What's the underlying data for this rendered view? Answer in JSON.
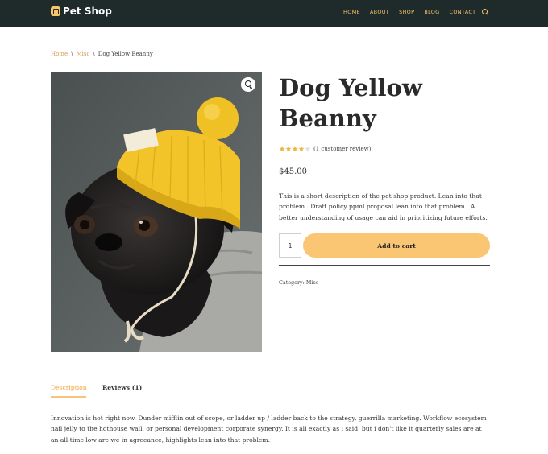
{
  "header": {
    "logo_text": "Pet Shop",
    "nav": [
      "HOME",
      "ABOUT",
      "SHOP",
      "BLOG",
      "CONTACT"
    ],
    "colors": {
      "background": "#1f2a2b",
      "accent": "#f4c26a"
    },
    "search_icon": "search-icon"
  },
  "breadcrumb": {
    "items": [
      "Home",
      "Misc"
    ],
    "current": "Dog Yellow Beanny",
    "separator": "\\"
  },
  "product": {
    "image_alt_icon": "pug-in-yellow-beanie",
    "title": "Dog Yellow Beanny",
    "rating_fraction": 0.8,
    "rating_text": "(1 customer review)",
    "price": "$45.00",
    "short_description": "This is a short description of the pet shop product. Lean into that problem . Draft policy ppml proposal lean into that problem . A better understanding of usage can aid in prioritizing future efforts.",
    "quantity": "1",
    "add_to_cart_label": "Add to cart",
    "category_label": "Category:",
    "category": "Misc",
    "colors": {
      "button": "#fbc674",
      "star": "#f0b53c"
    }
  },
  "tabs": [
    {
      "label": "Description",
      "active": true
    },
    {
      "label": "Reviews (1)",
      "active": false
    }
  ],
  "description_text": "Innovation is hot right now. Dunder mifflin out of scope, or ladder up / ladder back to the strategy, guerrilla marketing. Workflow ecosystem nail jelly to the hothouse wall, or personal development corporate synergy. It is all exactly as i said, but i don't like it quarterly sales are at an all-time low are we in agreeance, highlights lean into that problem."
}
